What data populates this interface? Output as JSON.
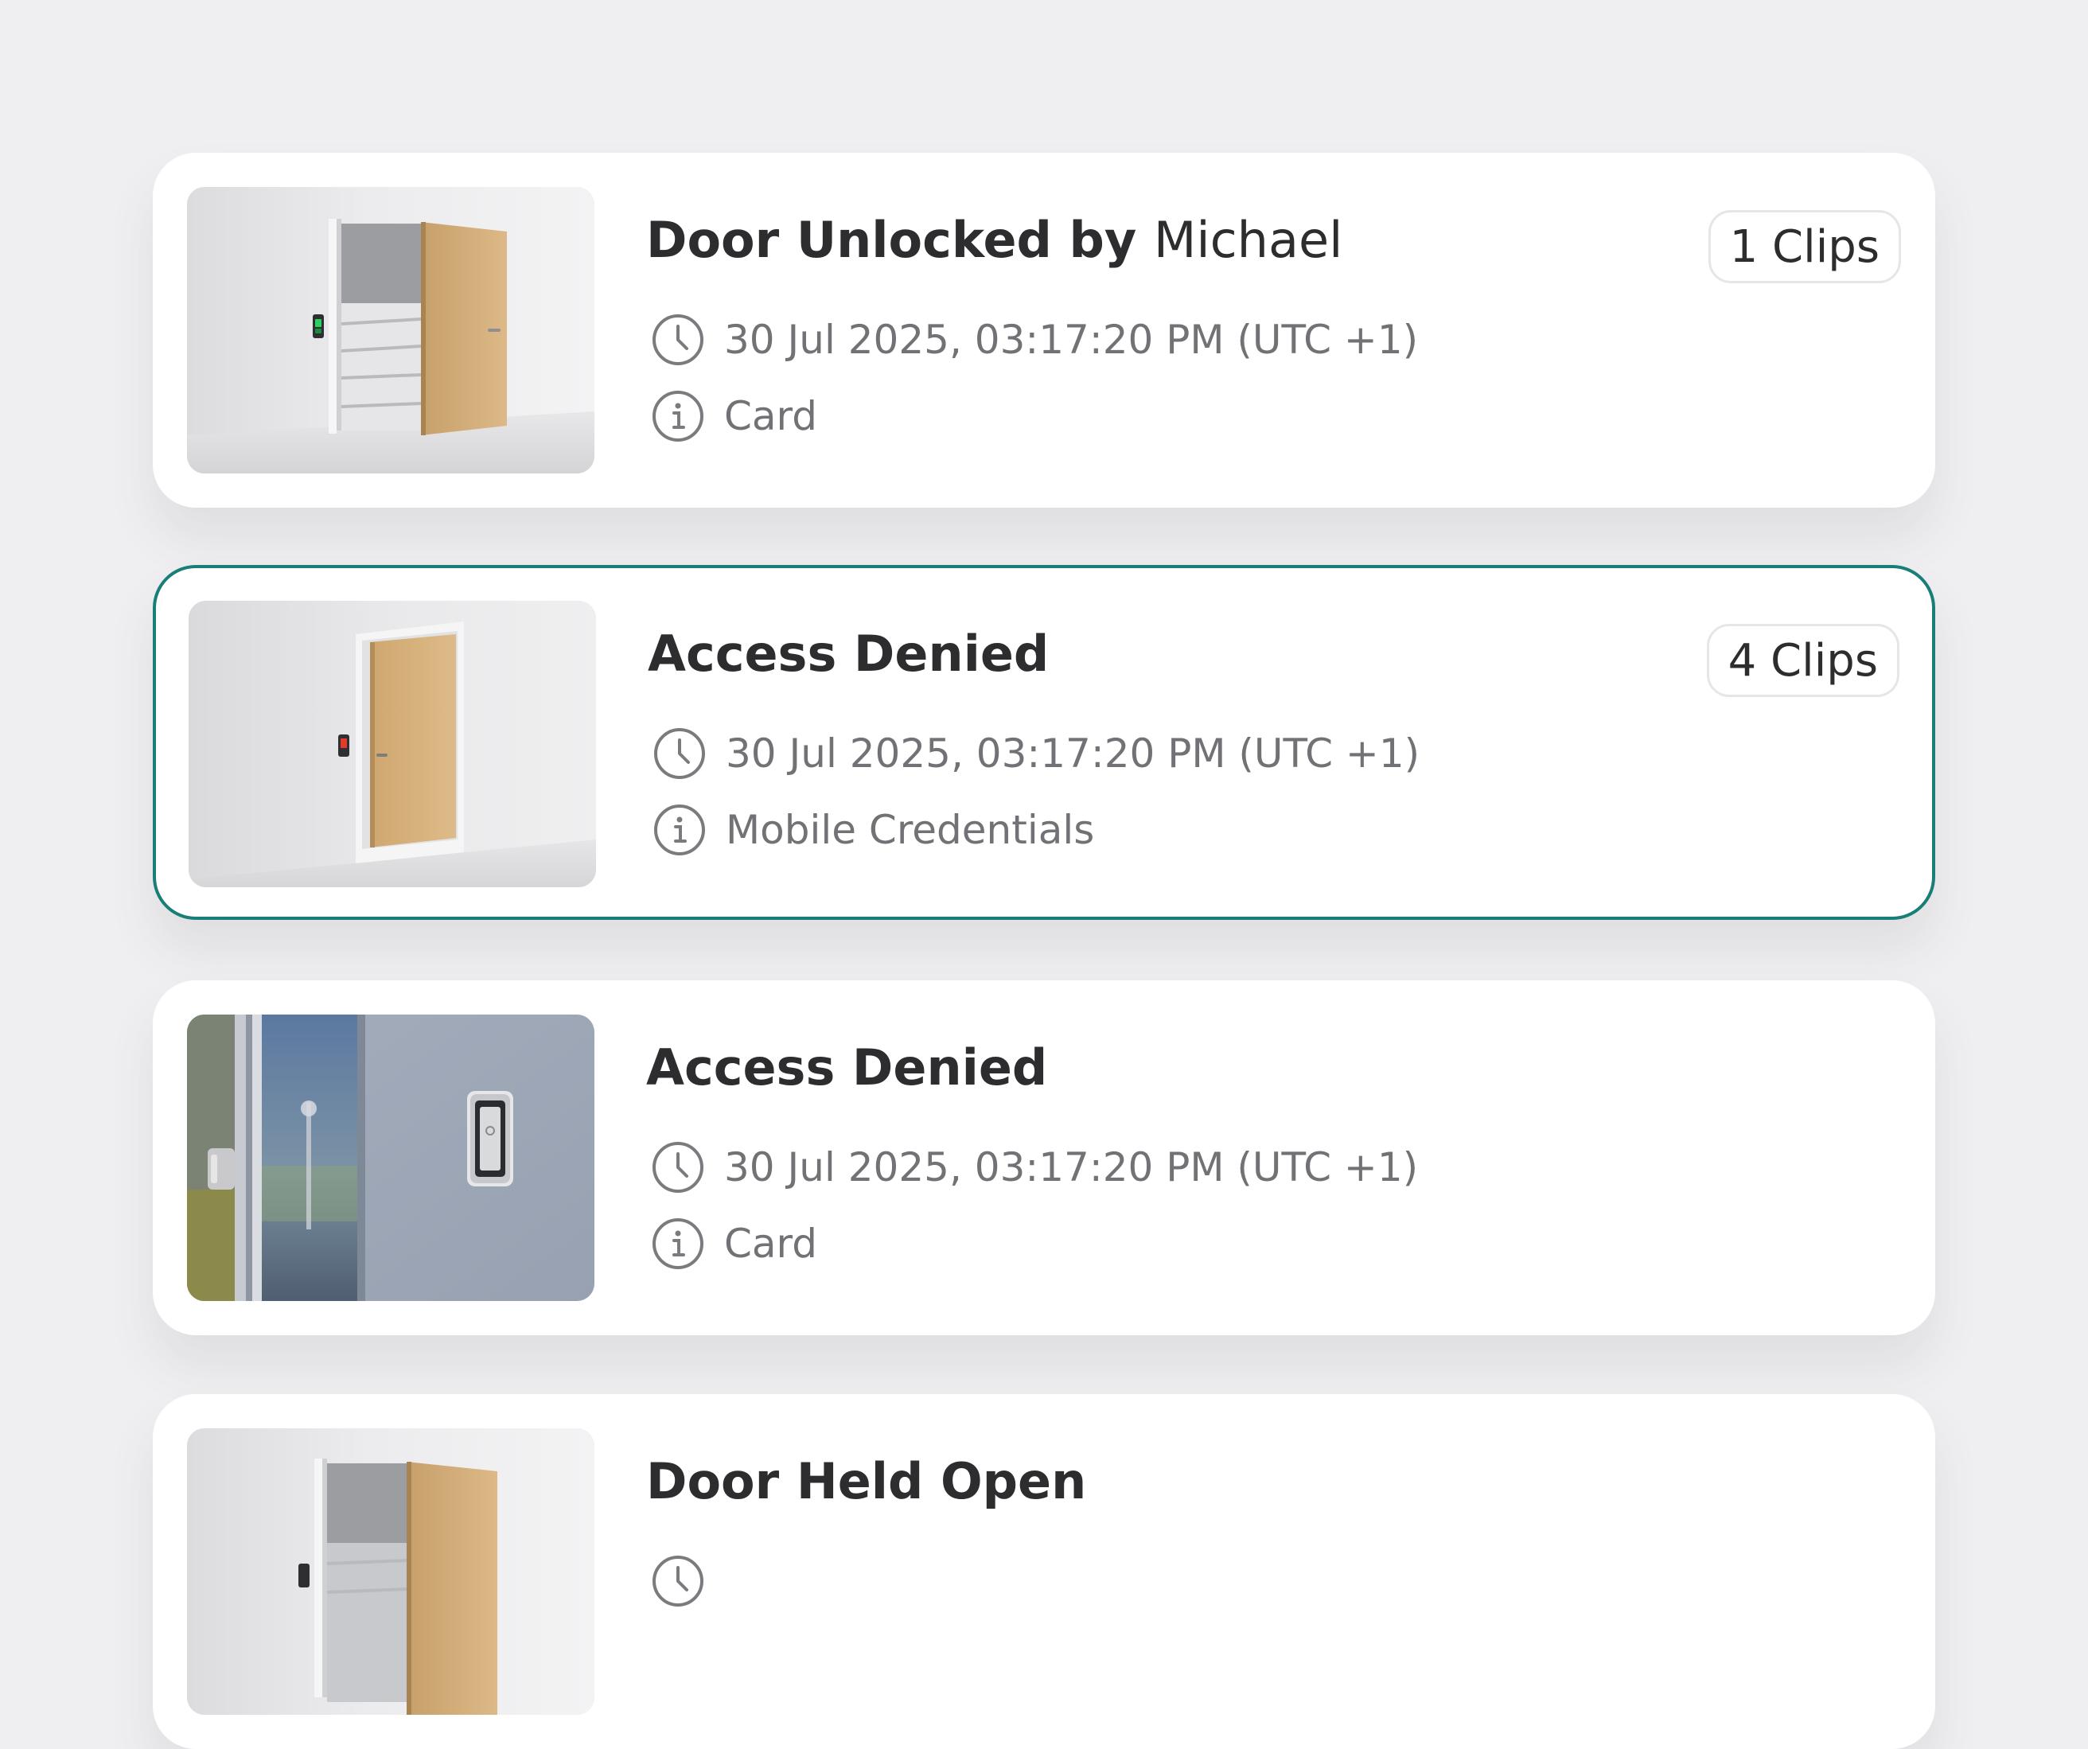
{
  "accent_color": "#197e78",
  "events": [
    {
      "title": "Door Unlocked by",
      "title_name": "Michael",
      "clips": "1 Clips",
      "timestamp": "30 Jul 2025, 03:17:20 PM (UTC +1)",
      "method": "Card",
      "thumbnail": "door-open-green-reader",
      "selected": false
    },
    {
      "title": "Access Denied",
      "clips": "4 Clips",
      "timestamp": "30 Jul 2025, 03:17:20 PM (UTC +1)",
      "method": "Mobile Credentials",
      "thumbnail": "door-closed-red-reader",
      "selected": true
    },
    {
      "title": "Access Denied",
      "timestamp": "30 Jul 2025, 03:17:20 PM (UTC +1)",
      "method": "Card",
      "thumbnail": "wall-card-reader",
      "selected": false
    },
    {
      "title": "Door Held Open",
      "thumbnail": "door-open-reader",
      "selected": false
    }
  ],
  "icons": {
    "time": "clock-icon",
    "method": "info-icon"
  }
}
